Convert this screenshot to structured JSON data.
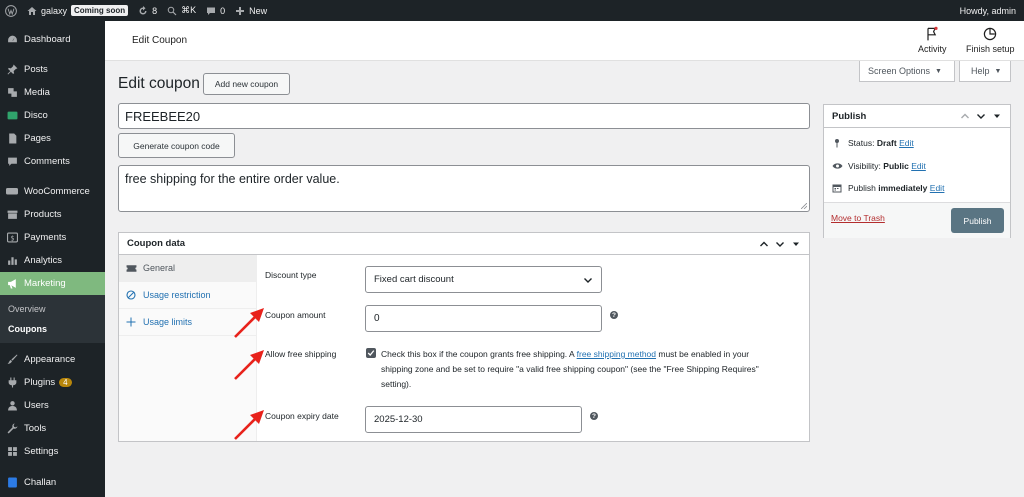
{
  "adminbar": {
    "site_name": "galaxy",
    "coming_soon": "Coming soon",
    "updates_count": "8",
    "search_shortcut": "⌘K",
    "comments_count": "0",
    "new_label": "New",
    "howdy": "Howdy, admin"
  },
  "sidebar": {
    "items": [
      {
        "label": "Dashboard",
        "icon": "dashboard-icon"
      },
      {
        "label": "Posts",
        "icon": "pin-icon"
      },
      {
        "label": "Media",
        "icon": "media-icon"
      },
      {
        "label": "Disco",
        "icon": "disco-icon"
      },
      {
        "label": "Pages",
        "icon": "page-icon"
      },
      {
        "label": "Comments",
        "icon": "comment-icon"
      },
      {
        "label": "WooCommerce",
        "icon": "woo-icon"
      },
      {
        "label": "Products",
        "icon": "archive-icon"
      },
      {
        "label": "Payments",
        "icon": "dollar-icon"
      },
      {
        "label": "Analytics",
        "icon": "chart-icon"
      },
      {
        "label": "Marketing",
        "icon": "megaphone-icon"
      },
      {
        "label": "Appearance",
        "icon": "brush-icon"
      },
      {
        "label": "Plugins",
        "icon": "plugin-icon",
        "badge": "4"
      },
      {
        "label": "Users",
        "icon": "users-icon"
      },
      {
        "label": "Tools",
        "icon": "wrench-icon"
      },
      {
        "label": "Settings",
        "icon": "settings-icon"
      },
      {
        "label": "Challan",
        "icon": "challan-icon"
      }
    ],
    "marketing_sub": [
      "Overview",
      "Coupons"
    ]
  },
  "header": {
    "title": "Edit Coupon",
    "activity": "Activity",
    "finish_setup": "Finish setup",
    "screen_options": "Screen Options",
    "help": "Help"
  },
  "page": {
    "title": "Edit coupon",
    "add_new": "Add new coupon",
    "coupon_code": "FREEBEE20",
    "generate": "Generate coupon code",
    "description": "free shipping for the entire order value."
  },
  "coupon_data": {
    "title": "Coupon data",
    "tabs": [
      "General",
      "Usage restriction",
      "Usage limits"
    ],
    "discount_type_label": "Discount type",
    "discount_type_value": "Fixed cart discount",
    "amount_label": "Coupon amount",
    "amount_value": "0",
    "free_shipping_label": "Allow free shipping",
    "free_shipping_text_a": "Check this box if the coupon grants free shipping. A ",
    "free_shipping_link": "free shipping method",
    "free_shipping_text_b": " must be enabled in your shipping zone and be set to require \"a valid free shipping coupon\" (see the \"Free Shipping Requires\" setting).",
    "expiry_label": "Coupon expiry date",
    "expiry_value": "2025-12-30"
  },
  "publish": {
    "title": "Publish",
    "status_label": "Status:",
    "status_value": "Draft",
    "visibility_label": "Visibility:",
    "visibility_value": "Public",
    "publish_label": "Publish",
    "publish_value": "immediately",
    "edit": "Edit",
    "trash": "Move to Trash",
    "button": "Publish"
  },
  "colors": {
    "accent": "#2271b1",
    "marketing_active": "#7fb97f",
    "publish_button": "#5a7583",
    "arrow": "#e8221b"
  }
}
